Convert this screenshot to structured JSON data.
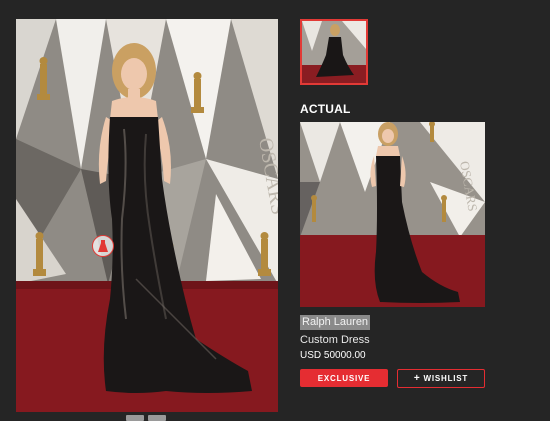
{
  "product": {
    "section_label": "ACTUAL",
    "brand": "Ralph Lauren",
    "name": "Custom Dress",
    "price": "USD 50000.00"
  },
  "buttons": {
    "exclusive": "EXCLUSIVE",
    "wishlist": "WISHLIST"
  },
  "icons": {
    "dress_hotspot": "dress-icon",
    "wishlist_plus": "plus-icon"
  },
  "colors": {
    "background": "#252525",
    "accent": "#e52d32",
    "carpet": "#8a1d22"
  }
}
